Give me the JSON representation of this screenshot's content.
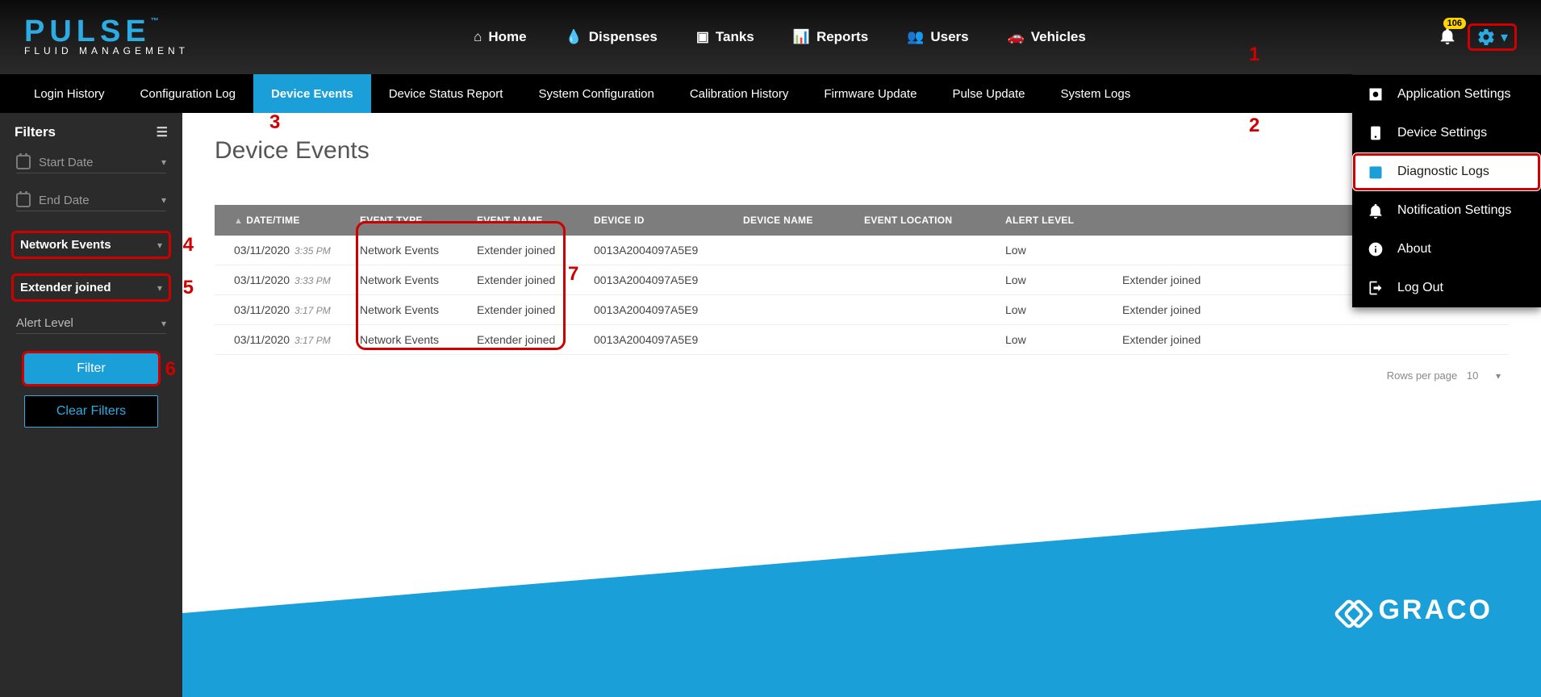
{
  "logo": {
    "brand": "PULSE",
    "tm": "™",
    "sub": "FLUID MANAGEMENT"
  },
  "top_nav": {
    "home": "Home",
    "dispenses": "Dispenses",
    "tanks": "Tanks",
    "reports": "Reports",
    "users": "Users",
    "vehicles": "Vehicles"
  },
  "notifications": {
    "count": "106"
  },
  "settings_menu": {
    "app_settings": "Application Settings",
    "device_settings": "Device Settings",
    "diagnostic_logs": "Diagnostic Logs",
    "notification_settings": "Notification Settings",
    "about": "About",
    "log_out": "Log Out"
  },
  "sub_nav": {
    "login_history": "Login History",
    "configuration_log": "Configuration Log",
    "device_events": "Device Events",
    "device_status_report": "Device Status Report",
    "system_configuration": "System Configuration",
    "calibration_history": "Calibration History",
    "firmware_update": "Firmware Update",
    "pulse_update": "Pulse Update",
    "system_logs": "System Logs"
  },
  "sidebar": {
    "filters_title": "Filters",
    "start_date": "Start Date",
    "end_date": "End Date",
    "event_type": "Network Events",
    "event_name": "Extender joined",
    "alert_level": "Alert Level",
    "filter_btn": "Filter",
    "clear_btn": "Clear Filters"
  },
  "page": {
    "title": "Device Events"
  },
  "columns": {
    "datetime": "DATE/TIME",
    "event_type": "EVENT TYPE",
    "event_name": "EVENT NAME",
    "device_id": "DEVICE ID",
    "device_name": "DEVICE NAME",
    "event_location": "EVENT LOCATION",
    "alert_level": "ALERT LEVEL",
    "extra": ""
  },
  "rows": [
    {
      "date": "03/11/2020",
      "time": "3:35 PM",
      "event_type": "Network Events",
      "event_name": "Extender joined",
      "device_id": "0013A2004097A5E9",
      "device_name": "",
      "event_location": "",
      "alert_level": "Low",
      "extra": ""
    },
    {
      "date": "03/11/2020",
      "time": "3:33 PM",
      "event_type": "Network Events",
      "event_name": "Extender joined",
      "device_id": "0013A2004097A5E9",
      "device_name": "",
      "event_location": "",
      "alert_level": "Low",
      "extra": "Extender joined"
    },
    {
      "date": "03/11/2020",
      "time": "3:17 PM",
      "event_type": "Network Events",
      "event_name": "Extender joined",
      "device_id": "0013A2004097A5E9",
      "device_name": "",
      "event_location": "",
      "alert_level": "Low",
      "extra": "Extender joined"
    },
    {
      "date": "03/11/2020",
      "time": "3:17 PM",
      "event_type": "Network Events",
      "event_name": "Extender joined",
      "device_id": "0013A2004097A5E9",
      "device_name": "",
      "event_location": "",
      "alert_level": "Low",
      "extra": "Extender joined"
    }
  ],
  "pagination": {
    "label": "Rows per page",
    "value": "10"
  },
  "brand_footer": "GRACO",
  "callouts": {
    "c1": "1",
    "c2": "2",
    "c3": "3",
    "c4": "4",
    "c5": "5",
    "c6": "6",
    "c7": "7"
  }
}
